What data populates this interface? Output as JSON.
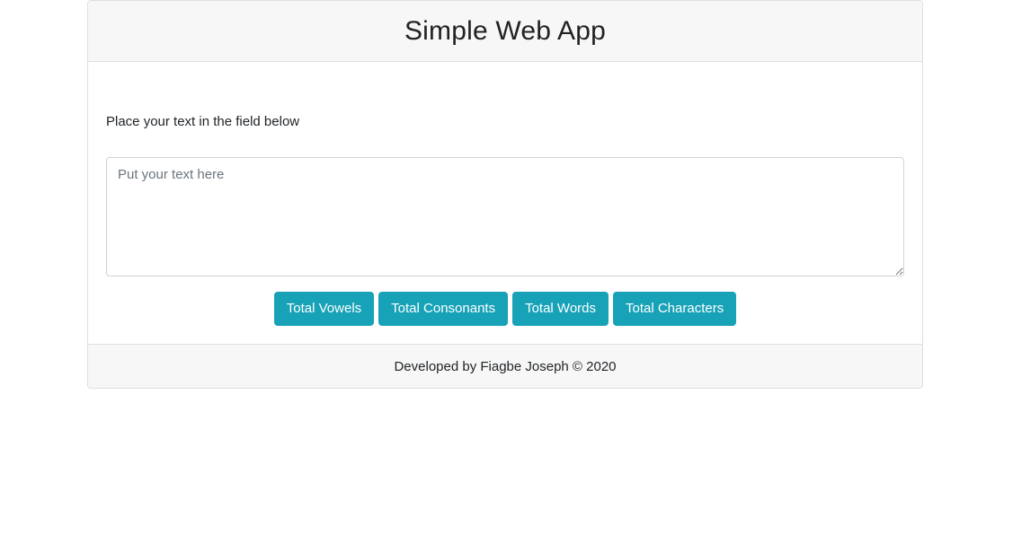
{
  "header": {
    "title": "Simple Web App"
  },
  "main": {
    "prompt": "Place your text in the field below",
    "textarea": {
      "value": "",
      "placeholder": "Put your text here"
    },
    "buttons": {
      "vowels": "Total Vowels",
      "consonants": "Total Consonants",
      "words": "Total Words",
      "characters": "Total Characters"
    }
  },
  "footer": {
    "text": "Developed by Fiagbe Joseph © 2020"
  },
  "colors": {
    "accent": "#17a2b8",
    "header_bg": "#f7f7f7",
    "border": "#dfdfdf"
  }
}
